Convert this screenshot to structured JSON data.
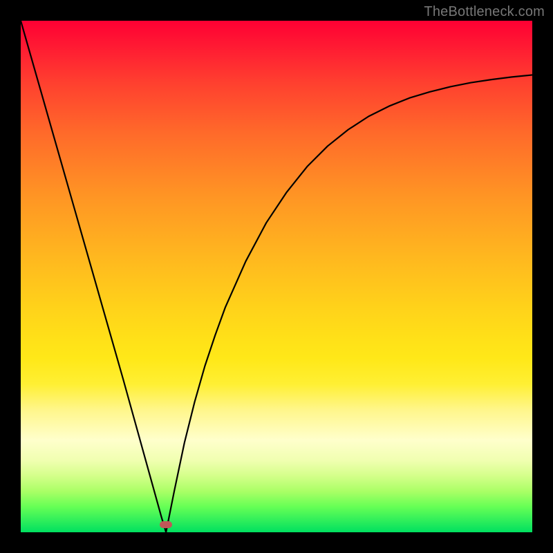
{
  "watermark": "TheBottleneck.com",
  "chart_data": {
    "type": "line",
    "title": "",
    "xlabel": "",
    "ylabel": "",
    "xlim": [
      0,
      100
    ],
    "ylim": [
      0,
      100
    ],
    "grid": false,
    "legend": false,
    "background_gradient": [
      "#ff0033",
      "#ff9424",
      "#ffe018",
      "#ffffcc",
      "#00e060"
    ],
    "curve": {
      "x": [
        0,
        2,
        4,
        6,
        8,
        10,
        12,
        14,
        16,
        18,
        20,
        22,
        24,
        26,
        27.5,
        28.4,
        30,
        32,
        34,
        36,
        38,
        40,
        44,
        48,
        52,
        56,
        60,
        64,
        68,
        72,
        76,
        80,
        84,
        88,
        92,
        96,
        100
      ],
      "y": [
        100,
        93.0,
        86.0,
        79.0,
        72.0,
        65.0,
        58.0,
        51.0,
        44.0,
        37.0,
        30.0,
        22.8,
        15.6,
        8.4,
        3.0,
        0.0,
        8.0,
        17.5,
        25.5,
        32.5,
        38.5,
        44.0,
        53.0,
        60.5,
        66.5,
        71.5,
        75.5,
        78.7,
        81.3,
        83.3,
        84.9,
        86.1,
        87.1,
        87.9,
        88.5,
        89.0,
        89.4
      ]
    },
    "marker": {
      "x": 28.4,
      "y": 1.5,
      "color": "#c05858"
    }
  }
}
